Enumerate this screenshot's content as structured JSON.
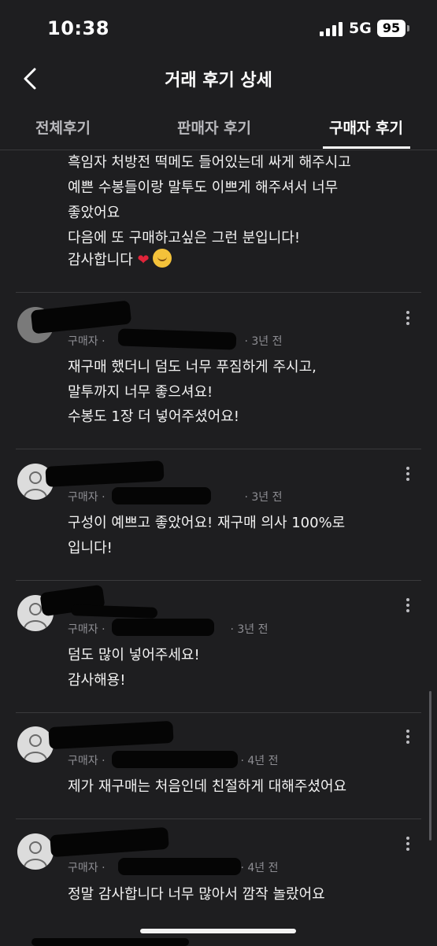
{
  "status_bar": {
    "time": "10:38",
    "network": "5G",
    "battery": "95"
  },
  "header": {
    "title": "거래 후기 상세"
  },
  "tabs": [
    {
      "label": "전체후기",
      "active": false
    },
    {
      "label": "판매자 후기",
      "active": false
    },
    {
      "label": "구매자 후기",
      "active": true
    }
  ],
  "reviews": [
    {
      "lines": [
        "흑임자 처방전 떡메도 들어있는데 싸게 해주시고",
        "예쁜 수봉들이랑 말투도 이쁘게 해주셔서 너무",
        "좋았어요",
        "다음에 또 구매하고싶은 그런 분입니다!",
        "감사합니다"
      ],
      "emoji_end": [
        "heart",
        "smiling-face"
      ]
    },
    {
      "role": "구매자",
      "time": "3년 전",
      "lines": [
        "재구매 했더니 덤도 너무 푸짐하게 주시고,",
        "말투까지 너무 좋으셔요!",
        "수봉도 1장 더 넣어주셨어요!"
      ]
    },
    {
      "role": "구매자",
      "time": "3년 전",
      "lines": [
        "구성이 예쁘고 좋았어요! 재구매 의사 100%로",
        "입니다!"
      ]
    },
    {
      "role": "구매자",
      "time": "3년 전",
      "lines": [
        "덤도 많이 넣어주세요!",
        "감사해용!"
      ]
    },
    {
      "role": "구매자",
      "time": "4년 전",
      "lines": [
        "제가 재구매는 처음인데 친절하게 대해주셨어요"
      ]
    },
    {
      "role": "구매자",
      "time": "4년 전",
      "lines": [
        "정말 감사합니다 너무 많아서 깜작 놀랐어요"
      ]
    }
  ],
  "colors": {
    "background": "#1e1e20",
    "text": "#ffffff",
    "muted": "#8e8e93",
    "divider": "#3a3a3c"
  }
}
